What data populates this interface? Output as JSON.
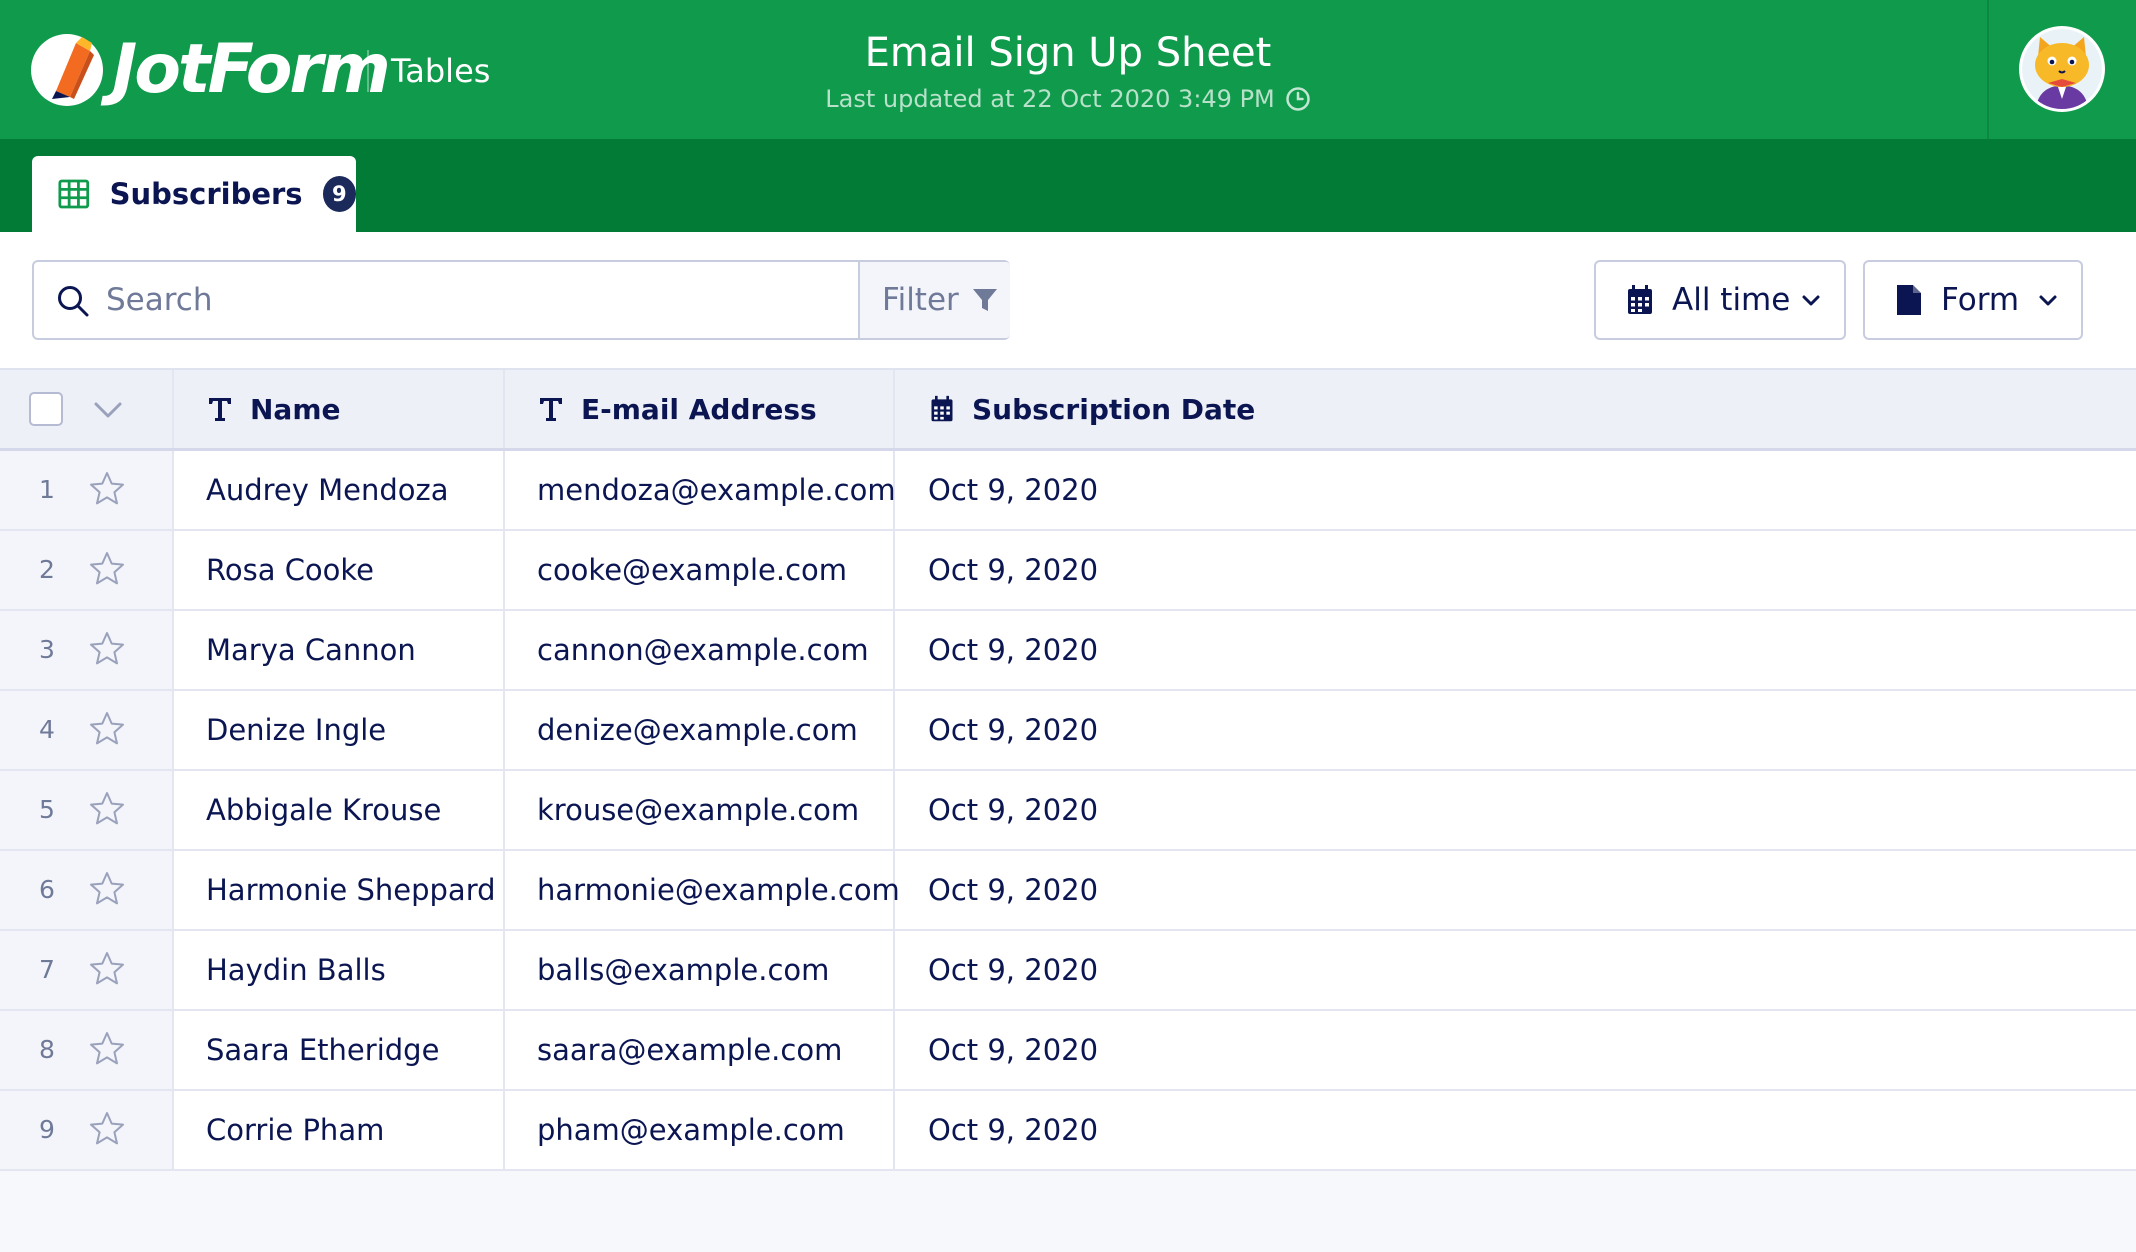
{
  "app": {
    "brand": "JotForm",
    "product": "Tables",
    "title": "Email Sign Up Sheet",
    "last_updated": "Last updated at 22 Oct 2020 3:49 PM"
  },
  "colors": {
    "header_green": "#0f9a4c",
    "tab_bar_green": "#027b37",
    "text_navy": "#0a1551",
    "muted": "#6f7a99"
  },
  "tab": {
    "label": "Subscribers",
    "count": "9",
    "icon": "grid-icon"
  },
  "toolbar": {
    "search_placeholder": "Search",
    "filter_label": "Filter",
    "date_range": "All time",
    "form_label": "Form"
  },
  "table": {
    "columns": [
      {
        "label": "Name",
        "icon": "text-type-icon"
      },
      {
        "label": "E-mail Address",
        "icon": "text-type-icon"
      },
      {
        "label": "Subscription Date",
        "icon": "calendar-icon"
      }
    ],
    "rows": [
      {
        "num": "1",
        "name": "Audrey Mendoza",
        "email": "mendoza@example.com",
        "date": "Oct 9, 2020"
      },
      {
        "num": "2",
        "name": "Rosa Cooke",
        "email": "cooke@example.com",
        "date": "Oct 9, 2020"
      },
      {
        "num": "3",
        "name": "Marya Cannon",
        "email": "cannon@example.com",
        "date": "Oct 9, 2020"
      },
      {
        "num": "4",
        "name": "Denize Ingle",
        "email": "denize@example.com",
        "date": "Oct 9, 2020"
      },
      {
        "num": "5",
        "name": "Abbigale Krouse",
        "email": "krouse@example.com",
        "date": "Oct 9, 2020"
      },
      {
        "num": "6",
        "name": "Harmonie Sheppard",
        "email": "harmonie@example.com",
        "date": "Oct 9, 2020"
      },
      {
        "num": "7",
        "name": "Haydin Balls",
        "email": "balls@example.com",
        "date": "Oct 9, 2020"
      },
      {
        "num": "8",
        "name": "Saara Etheridge",
        "email": "saara@example.com",
        "date": "Oct 9, 2020"
      },
      {
        "num": "9",
        "name": "Corrie Pham",
        "email": "pham@example.com",
        "date": "Oct 9, 2020"
      }
    ]
  }
}
